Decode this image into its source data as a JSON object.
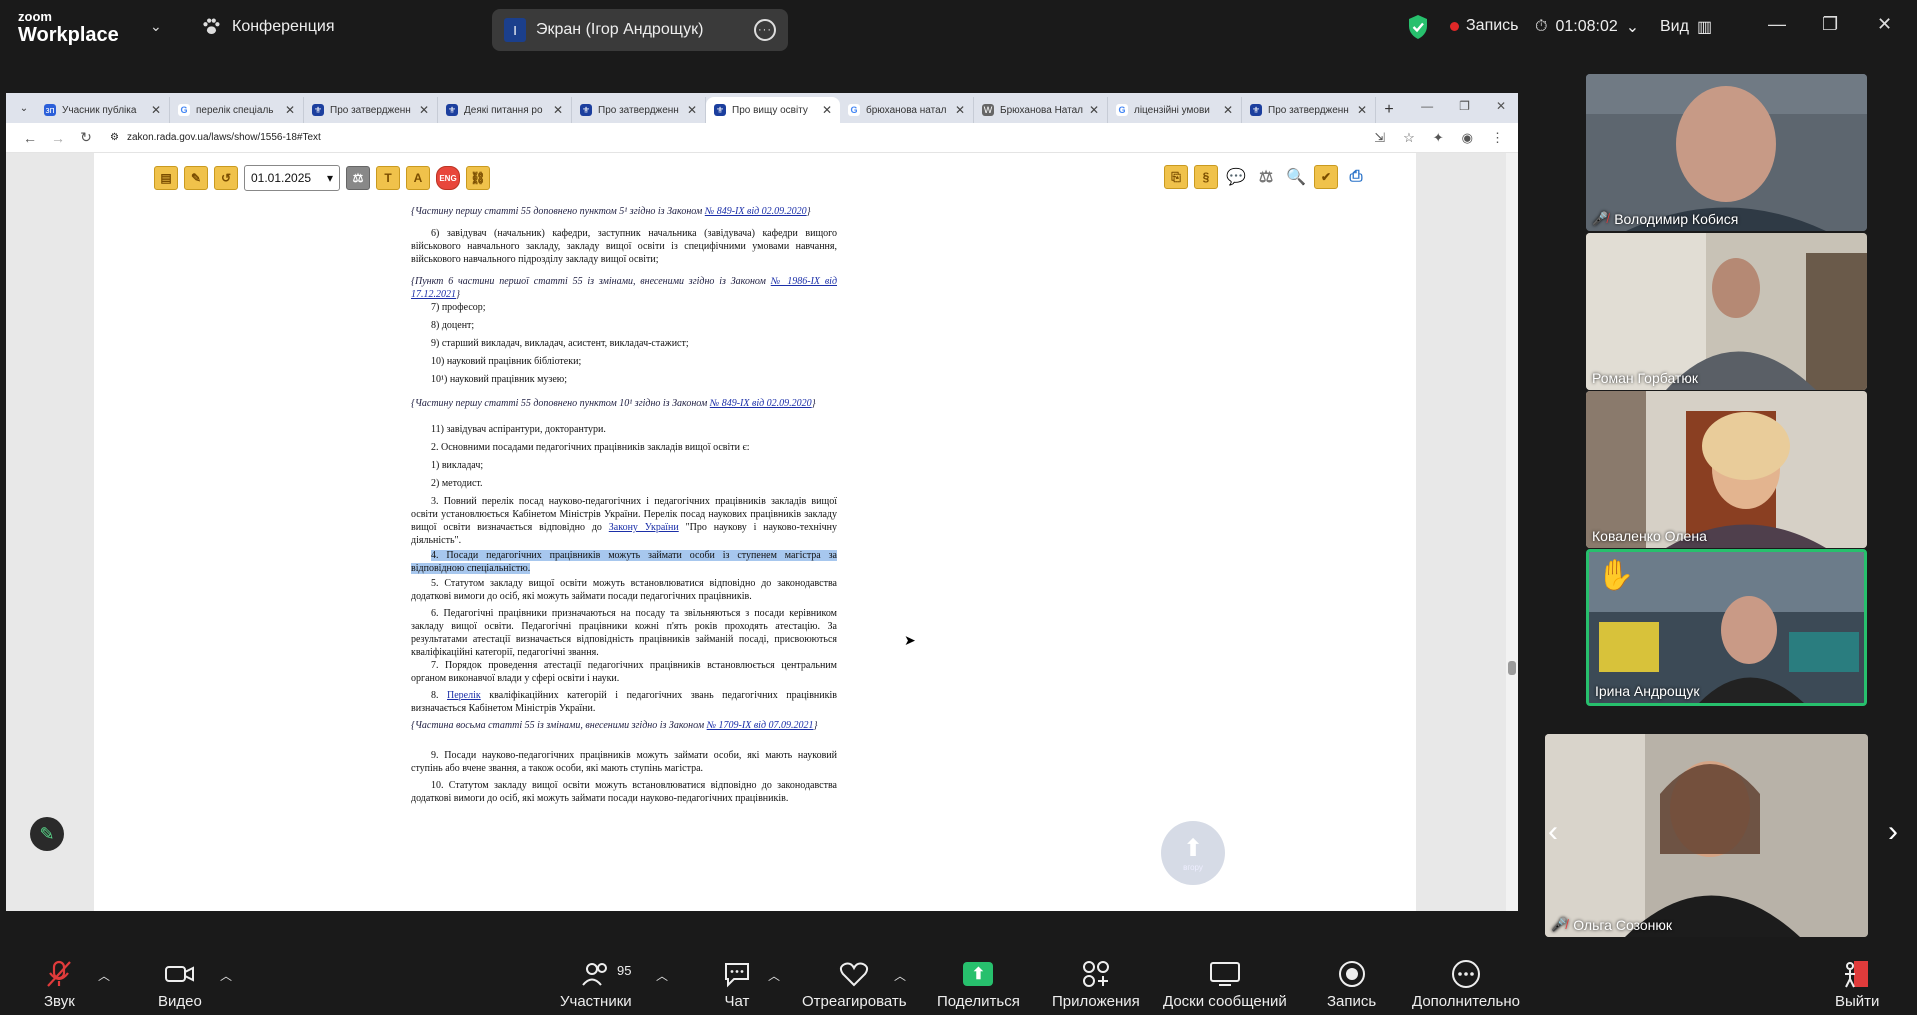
{
  "zoom": {
    "logo_line1": "zoom",
    "logo_line2": "Workplace",
    "meeting_title": "Конференция",
    "screen_share_label": "Экран (Ігор Андрощук)",
    "screen_share_initial": "I",
    "record_label": "Запись",
    "timer": "01:08:02",
    "view_label": "Вид"
  },
  "browser": {
    "tabs": [
      {
        "label": "Учасник публіка",
        "fav": "зп",
        "color": "#2b5fd9",
        "active": false
      },
      {
        "label": "перелік спеціаль",
        "fav": "G",
        "color": "#ffffff",
        "active": false
      },
      {
        "label": "Про затвердженн",
        "fav": "⚜",
        "color": "#1c3f9e",
        "active": false
      },
      {
        "label": "Деякі питання ро",
        "fav": "⚜",
        "color": "#1c3f9e",
        "active": false
      },
      {
        "label": "Про затвердженн",
        "fav": "⚜",
        "color": "#1c3f9e",
        "active": false
      },
      {
        "label": "Про вищу освіту",
        "fav": "⚜",
        "color": "#1c3f9e",
        "active": true
      },
      {
        "label": "брюханова натал",
        "fav": "G",
        "color": "#ffffff",
        "active": false
      },
      {
        "label": "Брюханова Натал",
        "fav": "W",
        "color": "#666666",
        "active": false
      },
      {
        "label": "ліцензійні умови",
        "fav": "G",
        "color": "#ffffff",
        "active": false
      },
      {
        "label": "Про затвердженн",
        "fav": "⚜",
        "color": "#1c3f9e",
        "active": false
      }
    ],
    "url": "zakon.rada.gov.ua/laws/show/1556-18#Text",
    "date_select": "01.01.2025",
    "up_button_label": "вгору"
  },
  "document": {
    "paragraphs": [
      {
        "text": "{Частину першу статті 55 доповнено пунктом 5¹ згідно із Законом ",
        "link": "№ 849-IX від 02.09.2020",
        "tail": "}",
        "type": "note"
      },
      {
        "text": "6) завідувач (начальник) кафедри, заступник начальника (завідувача) кафедри вищого військового навчального закладу, закладу вищої освіти із специфічними умовами навчання, військового навчального підрозділу закладу вищої освіти;",
        "type": "ind"
      },
      {
        "text": "{Пункт 6 частини першої статті 55 із змінами, внесеними згідно із Законом ",
        "link": "№ 1986-IX від 17.12.2021",
        "tail": "}",
        "type": "note"
      },
      {
        "text": "7) професор;",
        "type": "ind"
      },
      {
        "text": "8) доцент;",
        "type": "ind"
      },
      {
        "text": "9) старший викладач, викладач, асистент, викладач-стажист;",
        "type": "ind"
      },
      {
        "text": "10) науковий працівник бібліотеки;",
        "type": "ind"
      },
      {
        "text": "10¹) науковий працівник музею;",
        "type": "ind"
      },
      {
        "text": "{Частину першу статті 55 доповнено пунктом 10¹ згідно із Законом ",
        "link": "№ 849-IX від 02.09.2020",
        "tail": "}",
        "type": "note"
      },
      {
        "text": "11) завідувач аспірантури, докторантури.",
        "type": "ind"
      },
      {
        "text": "2. Основними посадами педагогічних працівників закладів вищої освіти є:",
        "type": "ind"
      },
      {
        "text": "1) викладач;",
        "type": "ind"
      },
      {
        "text": "2) методист.",
        "type": "ind"
      },
      {
        "text": "3. Повний перелік посад науково-педагогічних і педагогічних працівників закладів вищої освіти установлюється Кабінетом Міністрів України. Перелік посад наукових працівників закладу вищої освіти визначається відповідно до ",
        "link": "Закону України",
        "tail": " \"Про наукову і науково-технічну діяльність\".",
        "type": "ind"
      },
      {
        "text": "4. Посади педагогічних працівників можуть займати особи із ступенем магістра за відповідною спеціальністю.",
        "type": "hl"
      },
      {
        "text": "5. Статутом закладу вищої освіти можуть встановлюватися відповідно до законодавства додаткові вимоги до осіб, які можуть займати посади педагогічних працівників.",
        "type": "ind"
      },
      {
        "text": "6. Педагогічні працівники призначаються на посаду та звільняються з посади керівником закладу вищої освіти. Педагогічні працівники кожні п'ять років проходять атестацію. За результатами атестації визначається відповідність працівників займаній посаді, присвоюються кваліфікаційні категорії, педагогічні звання.",
        "type": "ind"
      },
      {
        "text": "7. Порядок проведення атестації педагогічних працівників встановлюється центральним органом виконавчої влади у сфері освіти і науки.",
        "type": "ind"
      },
      {
        "text": "8. ",
        "link": "Перелік",
        "tail": " кваліфікаційних категорій і педагогічних звань педагогічних працівників визначається Кабінетом Міністрів України.",
        "type": "ind"
      },
      {
        "text": "{Частина восьма статті 55 із змінами, внесеними згідно із Законом ",
        "link": "№ 1709-IX від 07.09.2021",
        "tail": "}",
        "type": "note"
      },
      {
        "text": "9. Посади науково-педагогічних працівників можуть займати особи, які мають науковий ступінь або вчене звання, а також особи, які мають ступінь магістра.",
        "type": "ind"
      },
      {
        "text": "10. Статутом закладу вищої освіти можуть встановлюватися відповідно до законодавства додаткові вимоги до осіб, які можуть займати посади науково-педагогічних працівників.",
        "type": "ind"
      }
    ]
  },
  "participants": [
    {
      "name": "Володимир Кобися",
      "muted": true
    },
    {
      "name": "Роман Горбатюк",
      "muted": false
    },
    {
      "name": "Коваленко Олена",
      "muted": false
    },
    {
      "name": "Ірина  Андрощук",
      "muted": false
    },
    {
      "name": "Ольга Созонюк",
      "muted": true
    }
  ],
  "toolbar": {
    "audio": "Звук",
    "video": "Видео",
    "participants": "Участники",
    "participants_count": "95",
    "chat": "Чат",
    "react": "Отреагировать",
    "share": "Поделиться",
    "apps": "Приложения",
    "whiteboards": "Доски сообщений",
    "record": "Запись",
    "more": "Дополнительно",
    "leave": "Выйти"
  }
}
